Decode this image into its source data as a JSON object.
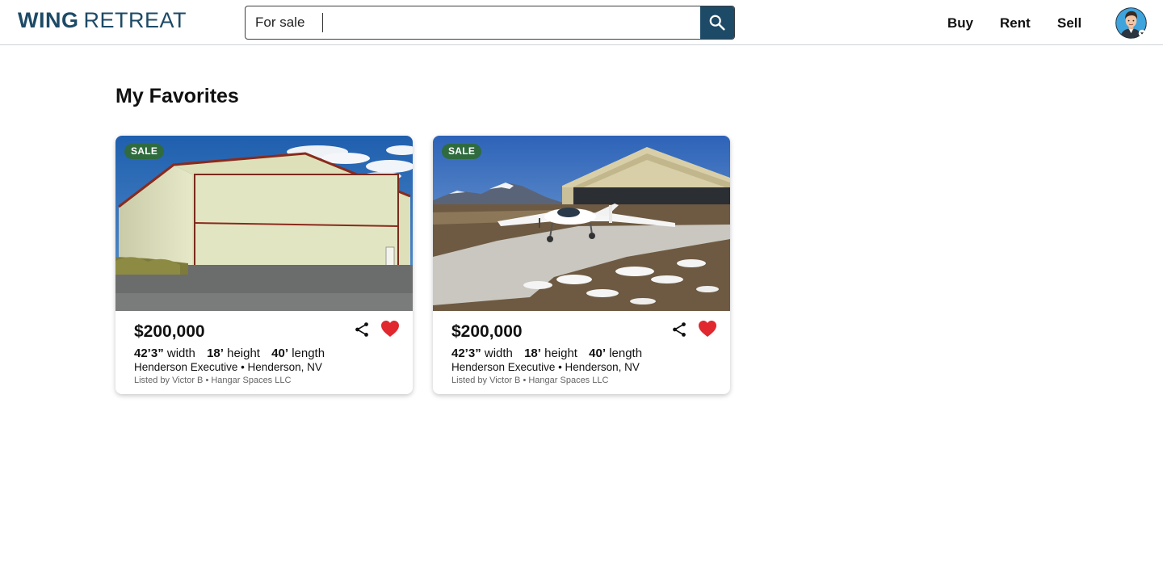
{
  "header": {
    "logo_bold": "WING",
    "logo_light": "RETREAT",
    "search": {
      "type_value": "For sale",
      "query_value": "",
      "query_placeholder": ""
    },
    "nav": {
      "buy": "Buy",
      "rent": "Rent",
      "sell": "Sell"
    },
    "icons": {
      "search": "search-icon",
      "avatar": "user-avatar",
      "avatar_caret": "caret-down-icon"
    },
    "colors": {
      "brand": "#1d4a66"
    }
  },
  "main": {
    "title": "My Favorites",
    "listings": [
      {
        "badge": "SALE",
        "price": "$200,000",
        "width_value": "42’3”",
        "width_label": "width",
        "height_value": "18’",
        "height_label": "height",
        "length_value": "40’",
        "length_label": "length",
        "location": "Henderson Executive • Henderson, NV",
        "listed_by": "Listed by Victor B • Hangar Spaces LLC",
        "image": "hangar-exterior-photo",
        "favorited": true
      },
      {
        "badge": "SALE",
        "price": "$200,000",
        "width_value": "42’3”",
        "width_label": "width",
        "height_value": "18’",
        "height_label": "height",
        "length_value": "40’",
        "length_label": "length",
        "location": "Henderson Executive • Henderson, NV",
        "listed_by": "Listed by Victor B • Hangar Spaces LLC",
        "image": "hangar-with-airplane-photo",
        "favorited": true
      }
    ],
    "colors": {
      "badge": "#2f6b3f",
      "heart": "#e0282e"
    }
  }
}
